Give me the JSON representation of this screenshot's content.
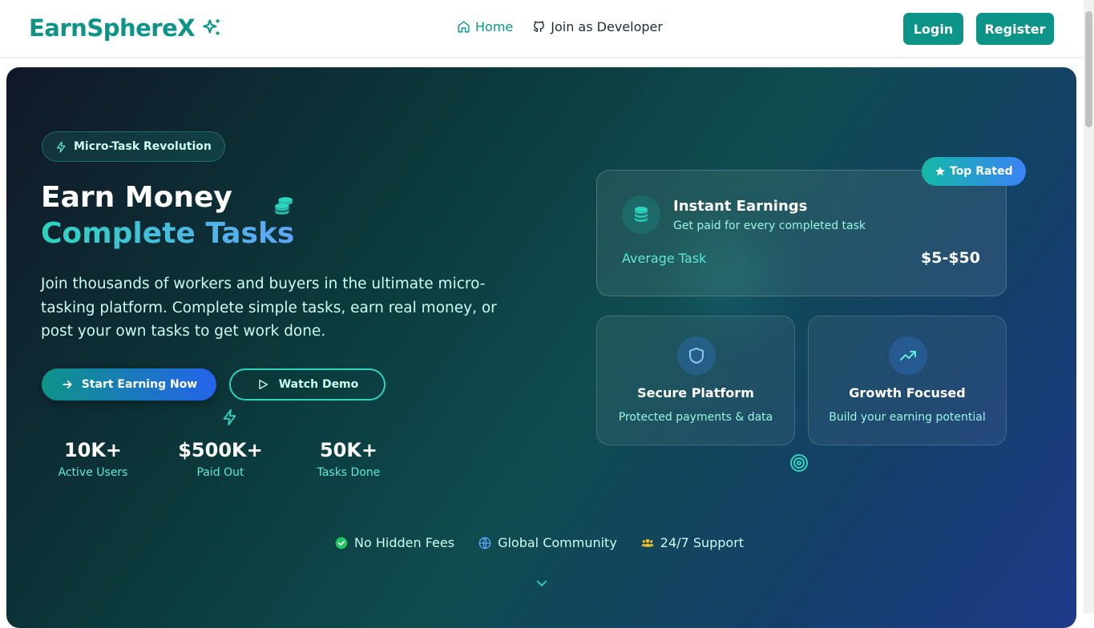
{
  "nav": {
    "brand": "EarnSphereX",
    "links": [
      {
        "label": "Home",
        "icon": "home-icon"
      },
      {
        "label": "Join as Developer",
        "icon": "github-icon"
      }
    ],
    "login": "Login",
    "register": "Register"
  },
  "hero": {
    "badge": "Micro-Task Revolution",
    "title_line1": "Earn Money",
    "title_line2": "Complete Tasks",
    "lead": "Join thousands of workers and buyers in the ultimate micro-tasking platform. Complete simple tasks, earn real money, or post your own tasks to get work done.",
    "cta_primary": "Start Earning Now",
    "cta_secondary": "Watch Demo",
    "stats": [
      {
        "value": "10K+",
        "label": "Active Users"
      },
      {
        "value": "$500K+",
        "label": "Paid Out"
      },
      {
        "value": "50K+",
        "label": "Tasks Done"
      }
    ]
  },
  "cards": {
    "top_badge": "Top Rated",
    "main": {
      "title": "Instant Earnings",
      "subtitle": "Get paid for every completed task",
      "avg_label": "Average Task",
      "avg_value": "$5-$50"
    },
    "secure": {
      "title": "Secure Platform",
      "subtitle": "Protected payments & data"
    },
    "growth": {
      "title": "Growth Focused",
      "subtitle": "Build your earning potential"
    }
  },
  "features": [
    {
      "label": "No Hidden Fees",
      "icon": "check-circle-icon"
    },
    {
      "label": "Global Community",
      "icon": "globe-icon"
    },
    {
      "label": "24/7 Support",
      "icon": "users-icon"
    }
  ],
  "colors": {
    "brand": "#0d9488",
    "accent_teal": "#2dd4bf",
    "accent_blue": "#60a5fa"
  }
}
